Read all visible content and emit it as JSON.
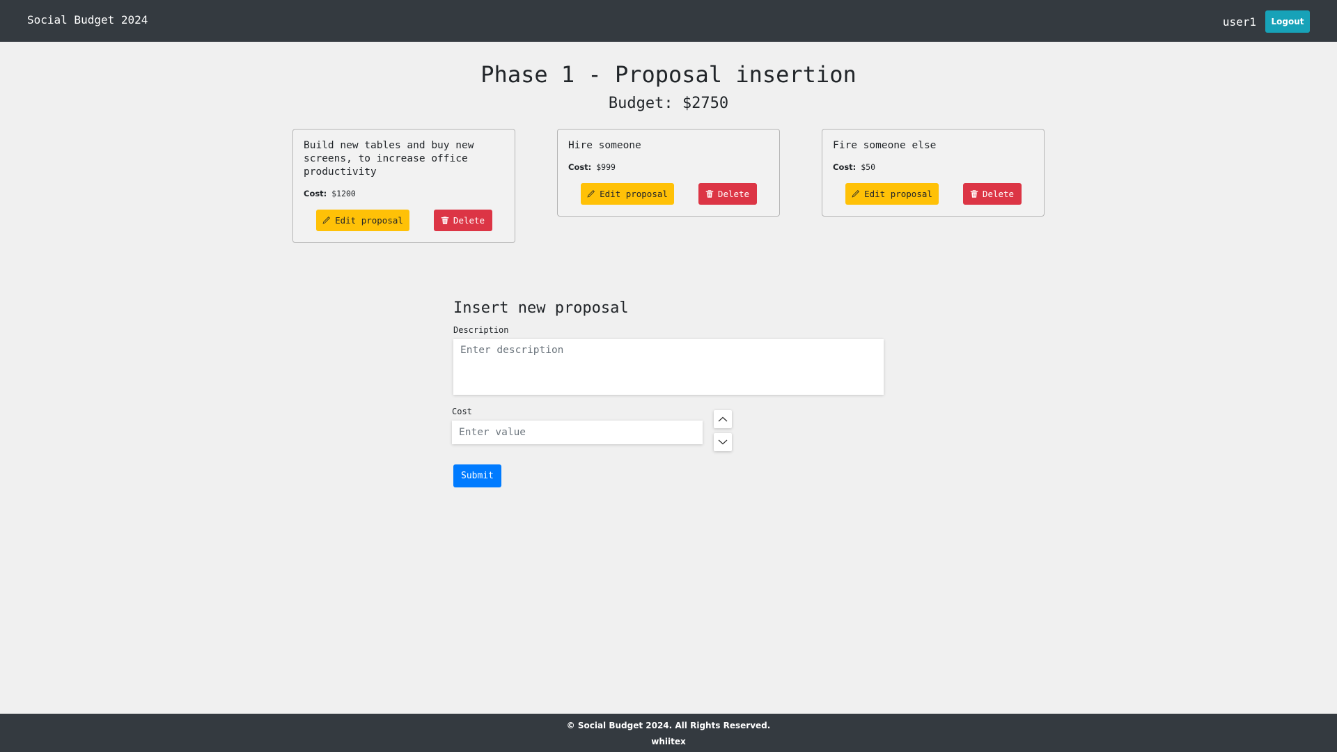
{
  "navbar": {
    "brand": "Social Budget 2024",
    "username": "user1",
    "logout_label": "Logout"
  },
  "header": {
    "title": "Phase 1 - Proposal insertion",
    "budget": "Budget: $2750"
  },
  "proposals": [
    {
      "description": "Build new tables and buy new screens, to increase office productivity",
      "cost_label": "Cost:",
      "cost_value": "$1200",
      "edit_label": "Edit proposal",
      "delete_label": "Delete"
    },
    {
      "description": "Hire someone",
      "cost_label": "Cost:",
      "cost_value": "$999",
      "edit_label": "Edit proposal",
      "delete_label": "Delete"
    },
    {
      "description": "Fire someone else",
      "cost_label": "Cost:",
      "cost_value": "$50",
      "edit_label": "Edit proposal",
      "delete_label": "Delete"
    }
  ],
  "form": {
    "title": "Insert new proposal",
    "description_label": "Description",
    "description_placeholder": "Enter description",
    "cost_label": "Cost",
    "cost_placeholder": "Enter value",
    "submit_label": "Submit"
  },
  "footer": {
    "copyright": "© Social Budget 2024. All Rights Reserved.",
    "author": "whiitex"
  },
  "icons": {
    "edit": "pencil-icon",
    "delete": "trash-icon",
    "increment": "chevron-up-icon",
    "decrement": "chevron-down-icon"
  },
  "colors": {
    "navbar": "#343a40",
    "logout": "#17a2b8",
    "edit": "#ffc107",
    "delete": "#dc3545",
    "submit": "#007bff",
    "background": "#f0f0f0"
  }
}
